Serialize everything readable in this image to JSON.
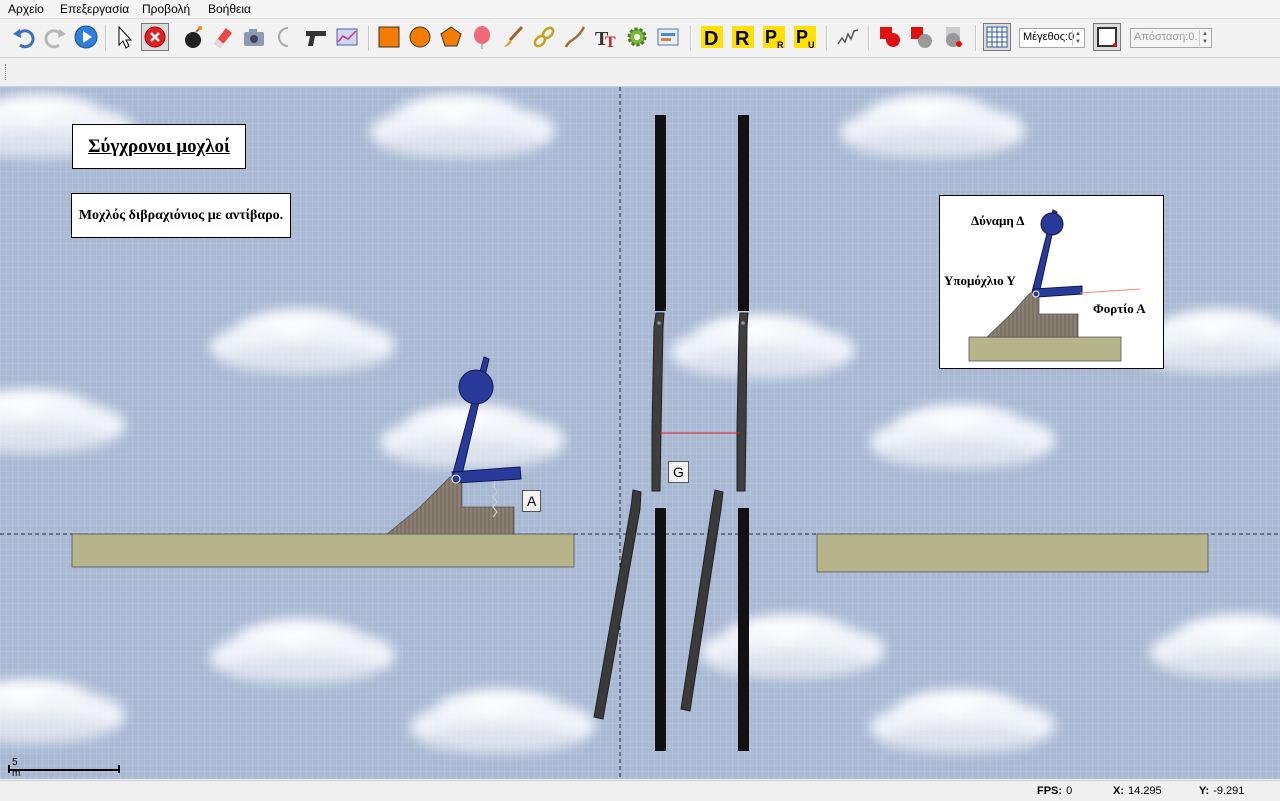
{
  "menu": {
    "items": [
      "Αρχείο",
      "Επεξεργασία",
      "Προβολή",
      "Βοήθεια"
    ]
  },
  "toolbar": {
    "size_spinner": "Μέγεθος:0",
    "distance_spinner": "Απόσταση:0.",
    "letter_tools": [
      "D",
      "R",
      "P",
      "P"
    ],
    "letter_subs": [
      "",
      "",
      "R",
      "U"
    ],
    "icons": [
      "undo-icon",
      "redo-icon",
      "play-icon",
      "select-pointer-icon",
      "delete-icon",
      "bomb-icon",
      "eraser-icon",
      "camera-icon",
      "hook-icon",
      "gun-icon",
      "graph-icon",
      "rectangle-icon",
      "circle-icon",
      "polygon-icon",
      "balloon-icon",
      "brush-icon",
      "chain-link-icon",
      "rope-icon",
      "text-icon",
      "gear-icon",
      "image-icon",
      "spring-icon",
      "collision-layer-icon",
      "grid-icon",
      "rectangle-outline-icon"
    ]
  },
  "scene": {
    "title": "Σύγχρονοι μοχλοί",
    "description": "Μοχλός διβραχιόνιος με αντίβαρο.",
    "tag_a": "A",
    "tag_g": "G",
    "info": {
      "force_label": "Δύναμη Δ",
      "fulcrum_label": "Υπομόχλιο Υ",
      "load_label": "Φορτίο Α"
    },
    "scale_label": "5 m"
  },
  "status": {
    "fps_label": "FPS:",
    "fps_value": "0",
    "x_label": "X:",
    "x_value": "14.295",
    "y_label": "Y:",
    "y_value": "-9.291"
  },
  "colors": {
    "sky": "#a9b9d4",
    "ground": "#b5b48a",
    "lever": "#2a3a9a",
    "post": "#111111",
    "accent_red": "#e02020"
  }
}
